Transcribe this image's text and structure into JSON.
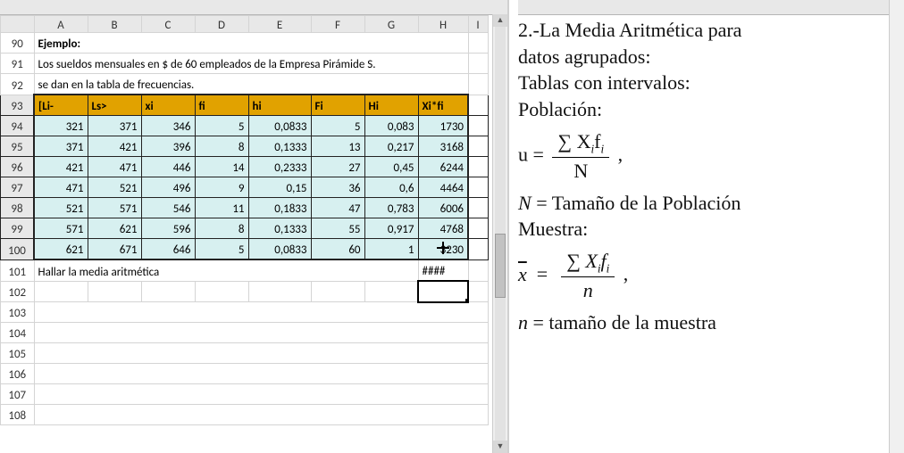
{
  "columns": [
    "A",
    "B",
    "C",
    "D",
    "E",
    "F",
    "G",
    "H",
    "I"
  ],
  "row_start": 90,
  "cells": {
    "r90": [
      "Ejemplo:",
      "",
      "",
      "",
      "",
      "",
      "",
      "",
      ""
    ],
    "r91": [
      "Los sueldos mensuales en $ de 60 empleados de la Empresa Pirámide S.",
      "",
      "",
      "",
      "",
      "",
      "",
      "",
      ""
    ],
    "r92": [
      "se dan en la tabla de frecuencias.",
      "",
      "",
      "",
      "",
      "",
      "",
      "",
      ""
    ],
    "r93": [
      "[Li-",
      "Ls>",
      "xi",
      "fi",
      "hi",
      "Fi",
      "Hi",
      "Xi*fi",
      ""
    ],
    "r94": [
      "321",
      "371",
      "346",
      "5",
      "0,0833",
      "5",
      "0,083",
      "1730",
      ""
    ],
    "r95": [
      "371",
      "421",
      "396",
      "8",
      "0,1333",
      "13",
      "0,217",
      "3168",
      ""
    ],
    "r96": [
      "421",
      "471",
      "446",
      "14",
      "0,2333",
      "27",
      "0,45",
      "6244",
      ""
    ],
    "r97": [
      "471",
      "521",
      "496",
      "9",
      "0,15",
      "36",
      "0,6",
      "4464",
      ""
    ],
    "r98": [
      "521",
      "571",
      "546",
      "11",
      "0,1833",
      "47",
      "0,783",
      "6006",
      ""
    ],
    "r99": [
      "571",
      "621",
      "596",
      "8",
      "0,1333",
      "55",
      "0,917",
      "4768",
      ""
    ],
    "r100": [
      "621",
      "671",
      "646",
      "5",
      "0,0833",
      "60",
      "1",
      "3230",
      ""
    ],
    "r101": [
      "Hallar la media aritmética",
      "",
      "",
      "",
      "",
      "",
      "",
      "####",
      ""
    ],
    "r102": [
      "",
      "",
      "",
      "",
      "",
      "",
      "",
      "",
      ""
    ],
    "r103": [
      "",
      "",
      "",
      "",
      "",
      "",
      "",
      "",
      ""
    ],
    "r104": [
      "",
      "",
      "",
      "",
      "",
      "",
      "",
      "",
      ""
    ],
    "r105": [
      "",
      "",
      "",
      "",
      "",
      "",
      "",
      "",
      ""
    ],
    "r106": [
      "",
      "",
      "",
      "",
      "",
      "",
      "",
      "",
      ""
    ],
    "r107": [
      "",
      "",
      "",
      "",
      "",
      "",
      "",
      "",
      ""
    ],
    "r108": [
      "",
      "",
      "",
      "",
      "",
      "",
      "",
      "",
      ""
    ]
  },
  "doc": {
    "l1": "2.-La Media Aritmética para",
    "l2": "datos agrupados:",
    "l3": "Tablas con intervalos:",
    "l4": "Población:",
    "poblacion_num": "∑ X",
    "poblacion_num_sub": "i",
    "poblacion_num2": "f",
    "poblacion_num2_sub": "i",
    "poblacion_den": "N",
    "l5a": "N",
    "l5b": " = Tamaño de la Población",
    "l6": "Muestra:",
    "muestra_num": "∑ X",
    "muestra_num_sub": "i",
    "muestra_num2": "f",
    "muestra_num2_sub": "i",
    "muestra_den": "n",
    "l7a": "n",
    "l7b": " = tamaño de la muestra"
  }
}
